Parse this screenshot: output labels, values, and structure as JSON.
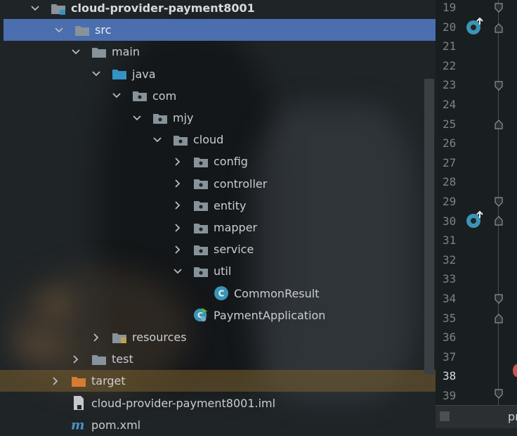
{
  "project_tree": {
    "items": [
      {
        "label": "cloud-provider-payment8001",
        "depth": 1,
        "expanded": true,
        "icon": "module-folder-icon",
        "bold": true
      },
      {
        "label": "src",
        "depth": 2,
        "expanded": true,
        "icon": "folder-icon",
        "selected": true
      },
      {
        "label": "main",
        "depth": 3,
        "expanded": true,
        "icon": "folder-icon"
      },
      {
        "label": "java",
        "depth": 4,
        "expanded": true,
        "icon": "source-folder-icon"
      },
      {
        "label": "com",
        "depth": 5,
        "expanded": true,
        "icon": "package-icon"
      },
      {
        "label": "mjy",
        "depth": 6,
        "expanded": true,
        "icon": "package-icon"
      },
      {
        "label": "cloud",
        "depth": 7,
        "expanded": true,
        "icon": "package-icon"
      },
      {
        "label": "config",
        "depth": 8,
        "expanded": false,
        "icon": "package-icon"
      },
      {
        "label": "controller",
        "depth": 8,
        "expanded": false,
        "icon": "package-icon"
      },
      {
        "label": "entity",
        "depth": 8,
        "expanded": false,
        "icon": "package-icon"
      },
      {
        "label": "mapper",
        "depth": 8,
        "expanded": false,
        "icon": "package-icon"
      },
      {
        "label": "service",
        "depth": 8,
        "expanded": false,
        "icon": "package-icon"
      },
      {
        "label": "util",
        "depth": 8,
        "expanded": true,
        "icon": "package-icon"
      },
      {
        "label": "CommonResult",
        "depth": 9,
        "expanded": null,
        "icon": "java-class-icon"
      },
      {
        "label": "PaymentApplication",
        "depth": 8,
        "expanded": null,
        "icon": "spring-boot-class-icon"
      },
      {
        "label": "resources",
        "depth": 4,
        "expanded": false,
        "icon": "resources-folder-icon"
      },
      {
        "label": "test",
        "depth": 3,
        "expanded": false,
        "icon": "folder-icon"
      },
      {
        "label": "target",
        "depth": 2,
        "expanded": false,
        "icon": "excluded-folder-icon"
      },
      {
        "label": "cloud-provider-payment8001.iml",
        "depth": 2,
        "expanded": null,
        "icon": "iml-file-icon"
      },
      {
        "label": "pom.xml",
        "depth": 2,
        "expanded": null,
        "icon": "maven-icon"
      }
    ]
  },
  "gutter": {
    "line_numbers": [
      "19",
      "20",
      "21",
      "22",
      "23",
      "24",
      "25",
      "26",
      "27",
      "28",
      "29",
      "30",
      "31",
      "32",
      "33",
      "34",
      "35",
      "36",
      "37",
      "38",
      "39"
    ],
    "current_line": "38"
  },
  "editor_tab_fragment": "pr",
  "colors": {
    "selection": "#4b6eaf",
    "folder": "#87939a",
    "source_folder": "#3592c4",
    "excluded_folder": "#d57b36",
    "class_badge": "#3a95b6",
    "text": "#c9cdd1"
  }
}
